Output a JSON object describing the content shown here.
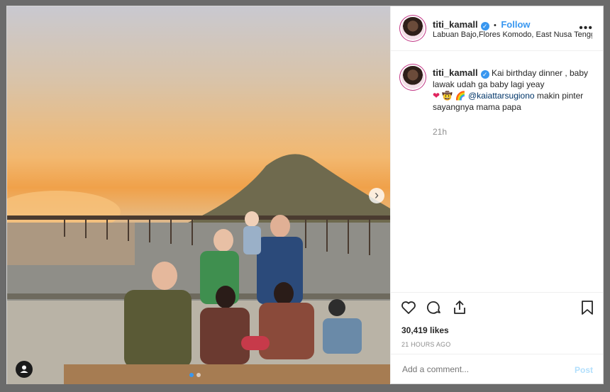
{
  "post": {
    "username": "titi_kamall",
    "verified_mark": "✓",
    "dot": "•",
    "follow_label": "Follow",
    "location": "Labuan Bajo,Flores Komodo, East Nusa Tengg...",
    "more_label": "•••",
    "caption": {
      "username": "titi_kamall",
      "text_part1": "Kai birthday dinner , baby lawak udah ga baby lagi yeay",
      "emoji_heart": "❤",
      "emoji_cowboy": "🤠",
      "emoji_rainbow": "🌈",
      "mention": "@kaiattarsugiono",
      "text_part2": " makin pinter sayangnya mama papa",
      "age": "21h"
    },
    "likes": "30,419 likes",
    "timestamp": "21 HOURS AGO",
    "comment_placeholder": "Add a comment...",
    "post_label": "Post",
    "carousel_next": "›",
    "carousel_dots": 2,
    "tag_icon": "user-tag-icon"
  },
  "colors": {
    "accent": "#3897f0",
    "post_disabled": "#b2dffc",
    "text": "#262626",
    "muted": "#8e8e8e",
    "mention": "#003569"
  }
}
